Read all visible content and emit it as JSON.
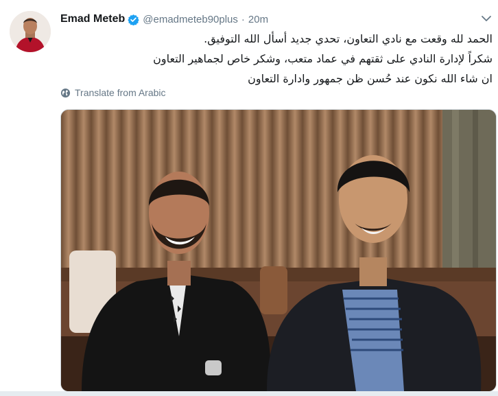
{
  "tweet": {
    "author_name": "Emad Meteb",
    "handle": "@emadmeteb90plus",
    "separator": "·",
    "timestamp": "20m",
    "text_lines": [
      "الحمد لله وقعت مع نادي التعاون، تحدي جديد أسأل الله التوفيق.",
      "شكراً لإدارة النادي على ثقتهم في عماد متعب، وشكر خاص لجماهير التعاون",
      "ان شاء الله نكون عند حُسن ظن جمهور وادارة التعاون"
    ],
    "translate_label": "Translate from Arabic"
  },
  "icons": {
    "verified": "verified-badge-icon",
    "caret": "chevron-down-icon",
    "translate": "globe-icon"
  },
  "colors": {
    "accent": "#1da1f2",
    "secondary_text": "#657786",
    "primary_text": "#14171a"
  }
}
